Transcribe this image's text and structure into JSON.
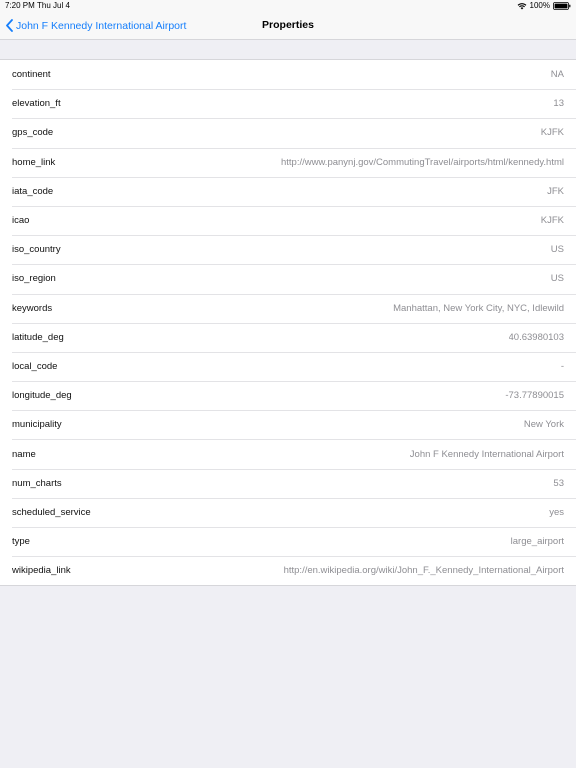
{
  "status_bar": {
    "time": "7:20 PM",
    "date": "Thu Jul 4",
    "battery": "100%"
  },
  "nav": {
    "back_label": "John F Kennedy International Airport",
    "title": "Properties"
  },
  "colors": {
    "accent": "#157efb",
    "background": "#efeff4",
    "value_text": "#8e8e93"
  },
  "properties": [
    {
      "key": "continent",
      "value": "NA"
    },
    {
      "key": "elevation_ft",
      "value": "13"
    },
    {
      "key": "gps_code",
      "value": "KJFK"
    },
    {
      "key": "home_link",
      "value": "http://www.panynj.gov/CommutingTravel/airports/html/kennedy.html"
    },
    {
      "key": "iata_code",
      "value": "JFK"
    },
    {
      "key": "icao",
      "value": "KJFK"
    },
    {
      "key": "iso_country",
      "value": "US"
    },
    {
      "key": "iso_region",
      "value": "US"
    },
    {
      "key": "keywords",
      "value": "Manhattan, New York City, NYC, Idlewild"
    },
    {
      "key": "latitude_deg",
      "value": "40.63980103"
    },
    {
      "key": "local_code",
      "value": "-"
    },
    {
      "key": "longitude_deg",
      "value": "-73.77890015"
    },
    {
      "key": "municipality",
      "value": "New York"
    },
    {
      "key": "name",
      "value": "John F Kennedy International Airport"
    },
    {
      "key": "num_charts",
      "value": "53"
    },
    {
      "key": "scheduled_service",
      "value": "yes"
    },
    {
      "key": "type",
      "value": "large_airport"
    },
    {
      "key": "wikipedia_link",
      "value": "http://en.wikipedia.org/wiki/John_F._Kennedy_International_Airport"
    }
  ]
}
